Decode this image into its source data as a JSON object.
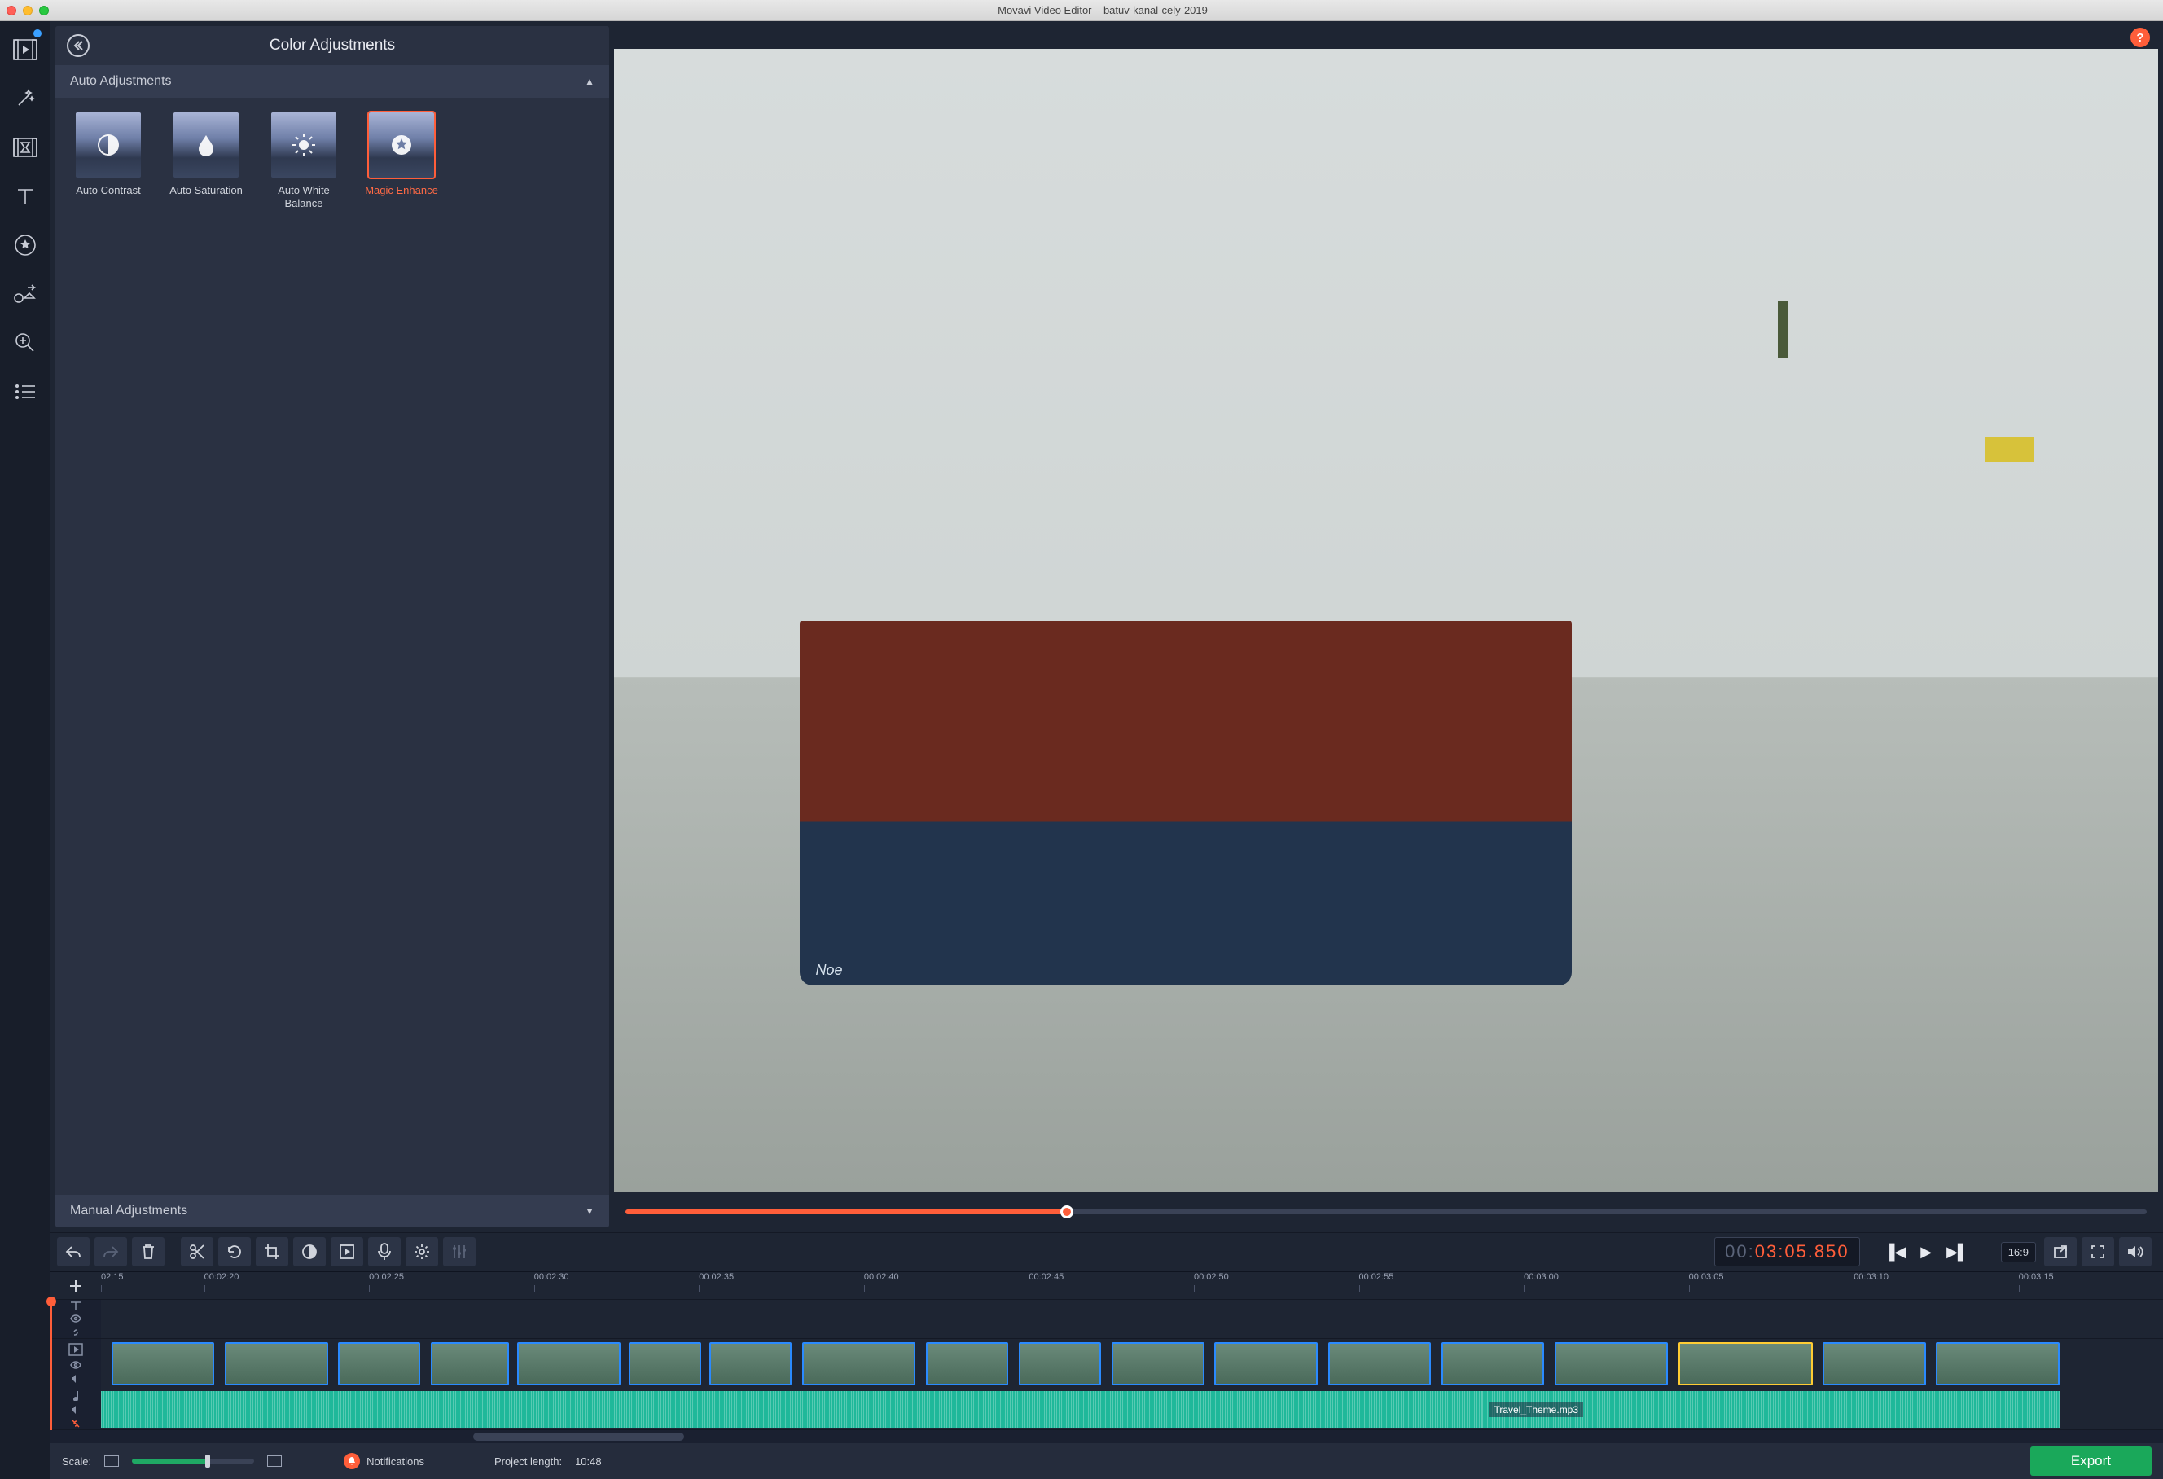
{
  "titlebar": {
    "title": "Movavi Video Editor – batuv-kanal-cely-2019"
  },
  "panel": {
    "title": "Color Adjustments",
    "section_auto": "Auto Adjustments",
    "section_manual": "Manual Adjustments",
    "thumbs": [
      {
        "label": "Auto Contrast",
        "selected": false,
        "icon": "contrast"
      },
      {
        "label": "Auto Saturation",
        "selected": false,
        "icon": "drop"
      },
      {
        "label": "Auto White Balance",
        "selected": false,
        "icon": "sun"
      },
      {
        "label": "Magic Enhance",
        "selected": true,
        "icon": "star"
      }
    ]
  },
  "rail": [
    "media-icon",
    "fx-wand-icon",
    "transitions-icon",
    "text-icon",
    "stickers-icon",
    "shapes-icon",
    "zoom-icon",
    "list-icon"
  ],
  "toolbar": {
    "items": [
      "undo",
      "redo",
      "delete",
      "cut",
      "rotate",
      "crop",
      "color",
      "clip-props",
      "mic",
      "settings",
      "equalizer"
    ]
  },
  "playback": {
    "timecode_dim": "00:",
    "timecode_hot": "03:05.850",
    "aspect": "16:9",
    "seek_pct": 29
  },
  "ruler": {
    "start_label": "02:15",
    "ticks": [
      "00:02:20",
      "00:02:25",
      "00:02:30",
      "00:02:35",
      "00:02:40",
      "00:02:45",
      "00:02:50",
      "00:02:55",
      "00:03:00",
      "00:03:05",
      "00:03:10",
      "00:03:15"
    ],
    "playhead_pct": 79
  },
  "audio": {
    "clip_label": "Travel_Theme.mp3"
  },
  "footer": {
    "scale_label": "Scale:",
    "notifications": "Notifications",
    "project_length_label": "Project length:",
    "project_length_value": "10:48",
    "export": "Export"
  },
  "help": "?",
  "preview_boat": "Noe"
}
